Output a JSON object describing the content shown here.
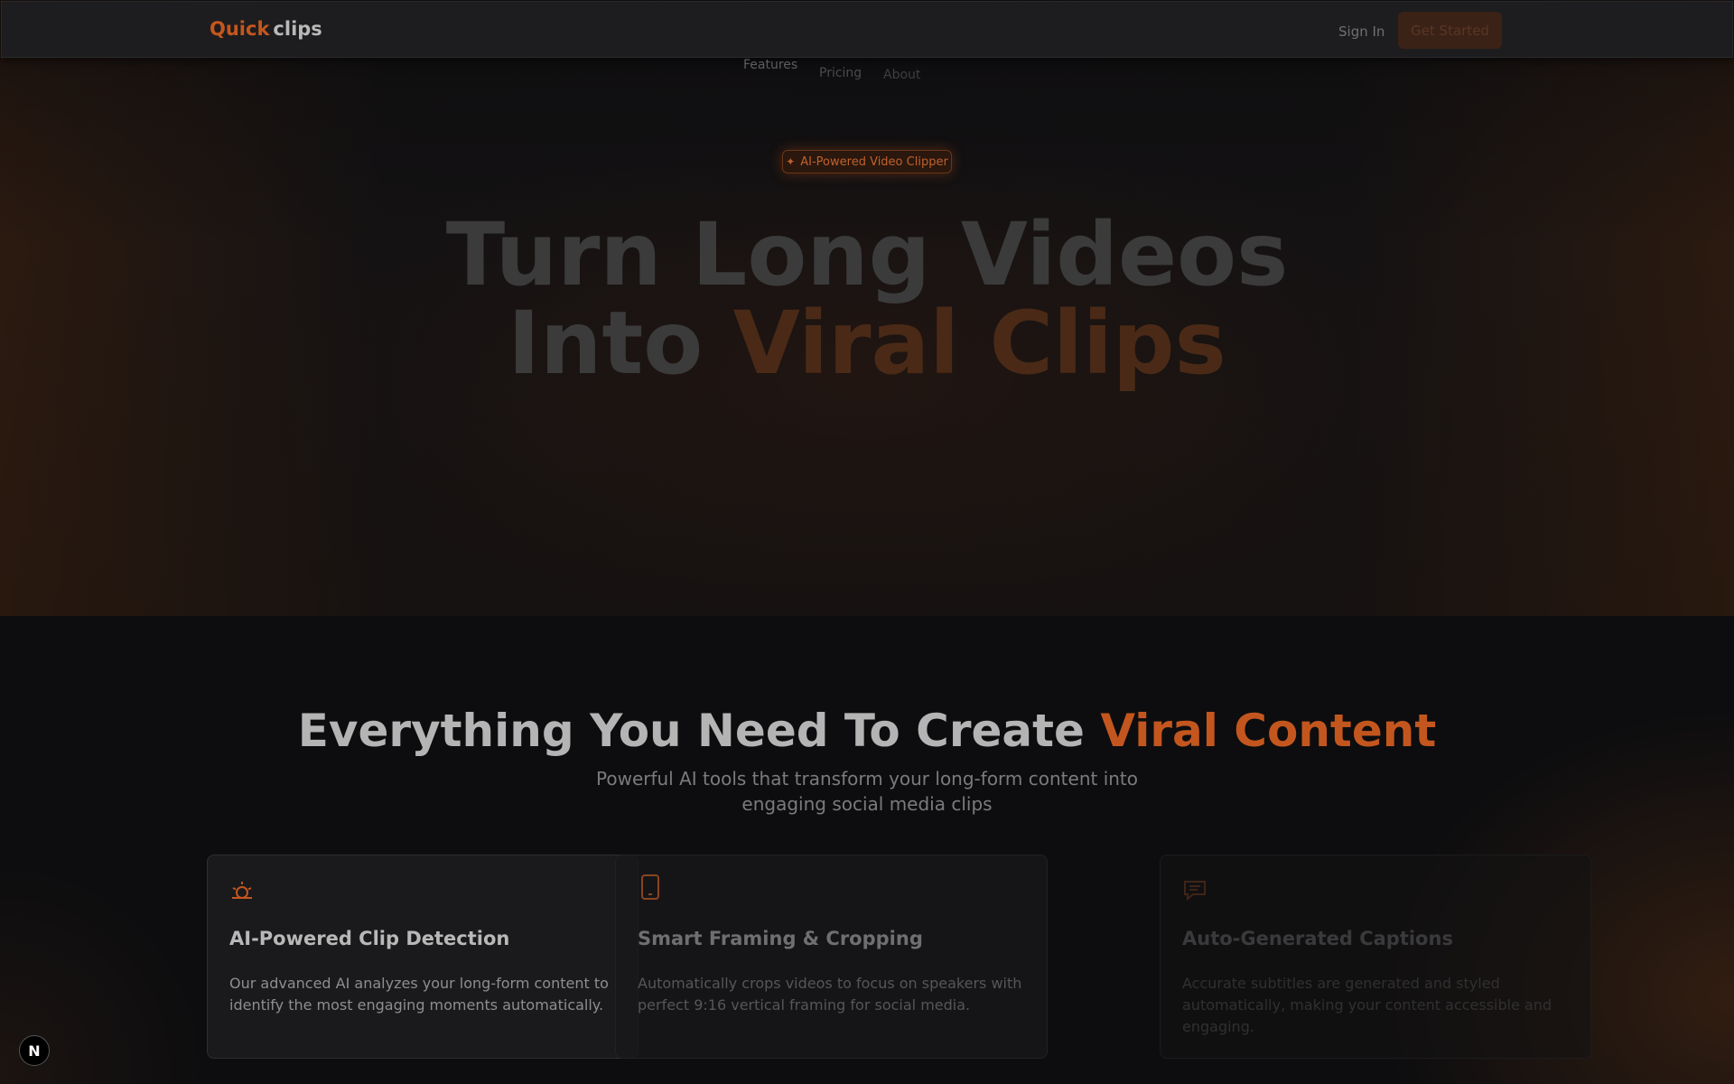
{
  "brand": {
    "quick": "Quick",
    "clips": "clips"
  },
  "header": {
    "sign_in": "Sign In",
    "get_started": "Get Started"
  },
  "nav": {
    "features": "Features",
    "pricing": "Pricing",
    "about": "About"
  },
  "hero": {
    "badge": "AI-Powered Video Clipper",
    "line1": "Turn Long Videos",
    "line2_prefix": "Into",
    "line2_accent": "Viral Clips"
  },
  "features": {
    "title_prefix": "Everything You Need To Create",
    "title_accent": "Viral Content",
    "subtitle": "Powerful AI tools that transform your long-form content into engaging social media clips",
    "cards": [
      {
        "title": "AI-Powered Clip Detection",
        "desc": "Our advanced AI analyzes your long-form content to identify the most engaging moments automatically.",
        "icon": "lightbulb-icon"
      },
      {
        "title": "Smart Framing & Cropping",
        "desc": "Automatically crops videos to focus on speakers with perfect 9:16 vertical framing for social media.",
        "icon": "phone-icon"
      },
      {
        "title": "Auto-Generated Captions",
        "desc": "Accurate subtitles are generated and styled automatically, making your content accessible and engaging.",
        "icon": "message-icon"
      }
    ]
  },
  "dev_badge": "N",
  "colors": {
    "accent": "#c3561e",
    "background": "#0d0d0f"
  }
}
